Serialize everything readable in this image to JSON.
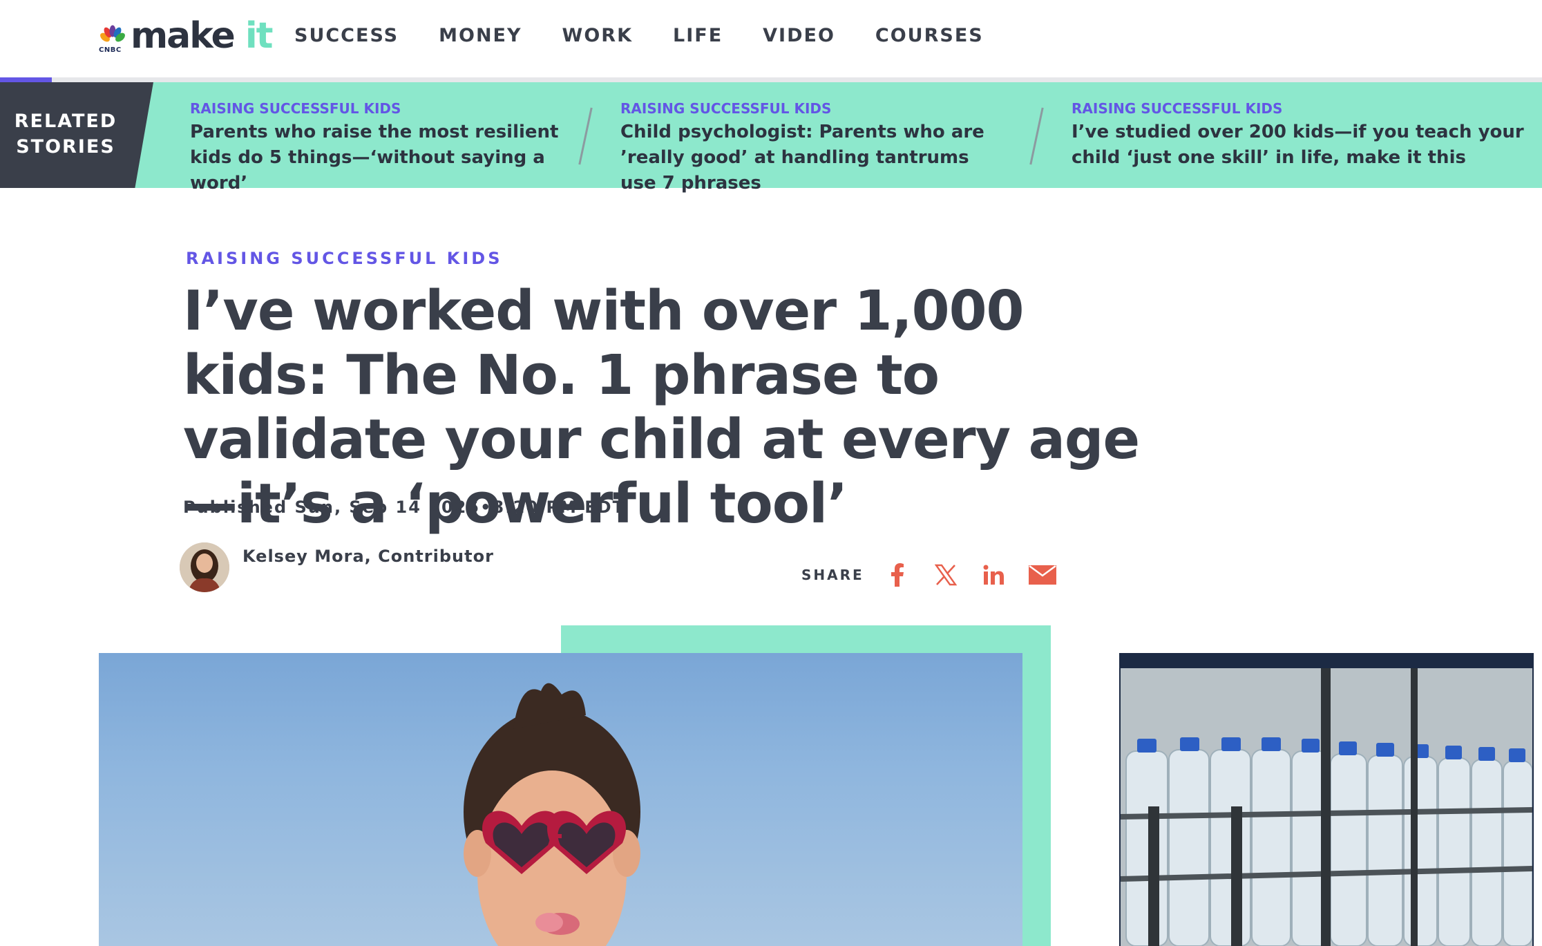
{
  "brand": {
    "network": "CNBC",
    "name": "make it",
    "name_main": "make ",
    "name_accent": "it"
  },
  "nav": {
    "items": [
      "SUCCESS",
      "MONEY",
      "WORK",
      "LIFE",
      "VIDEO",
      "COURSES"
    ]
  },
  "related": {
    "label": "RELATED STORIES",
    "stories": [
      {
        "kicker": "RAISING SUCCESSFUL KIDS",
        "title": "Parents who raise the most resilient kids do 5 things—‘without saying a word’"
      },
      {
        "kicker": "RAISING SUCCESSFUL KIDS",
        "title": "Child psychologist: Parents who are ’really good’ at handling tantrums use 7 phrases"
      },
      {
        "kicker": "RAISING SUCCESSFUL KIDS",
        "title": "I’ve studied over 200 kids—if you teach your child ‘just one skill’ in life, make it this"
      }
    ]
  },
  "article": {
    "kicker": "RAISING SUCCESSFUL KIDS",
    "headline": "I’ve worked with over 1,000 kids: The No. 1 phrase to validate your child at every age—it’s a ‘powerful tool’",
    "published": "Published Sun, Sep 14 2025•8:20 PM EDT",
    "author": "Kelsey Mora, Contributor"
  },
  "share": {
    "label": "SHARE",
    "icons": [
      "facebook-icon",
      "x-icon",
      "linkedin-icon",
      "email-icon"
    ],
    "color": "#e8604c"
  },
  "colors": {
    "accent": "#6356e5",
    "mint": "#8de8cc",
    "ink": "#3a3f4a"
  }
}
